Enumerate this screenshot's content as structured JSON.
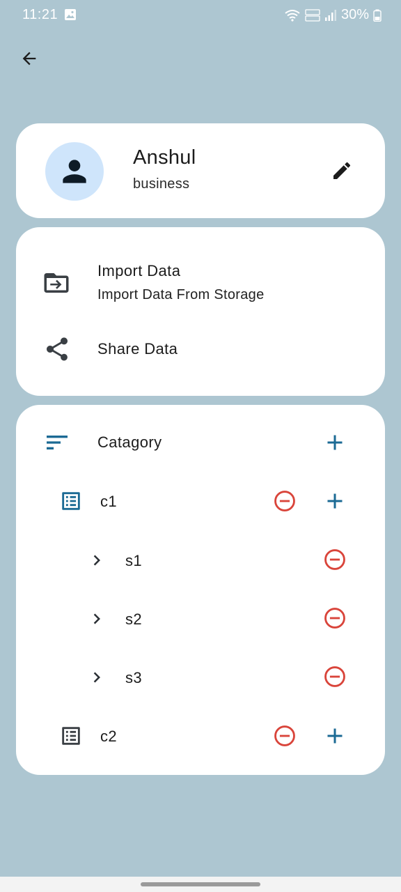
{
  "status_bar": {
    "time": "11:21",
    "battery": "30%"
  },
  "profile": {
    "name": "Anshul",
    "subtitle": "business"
  },
  "data_actions": {
    "import_title": "Import Data",
    "import_subtitle": "Import Data From Storage",
    "share_title": "Share Data"
  },
  "category": {
    "header": "Catagory",
    "items": [
      {
        "label": "c1",
        "sub_items": [
          {
            "label": "s1"
          },
          {
            "label": "s2"
          },
          {
            "label": "s3"
          }
        ]
      },
      {
        "label": "c2",
        "sub_items": []
      }
    ]
  },
  "colors": {
    "background": "#adc6d1",
    "card": "#ffffff",
    "accent_blue": "#1b6a94",
    "remove_red": "#d9443a",
    "avatar_bg": "#cfe5fb",
    "icon_dark": "#3a3f44"
  }
}
